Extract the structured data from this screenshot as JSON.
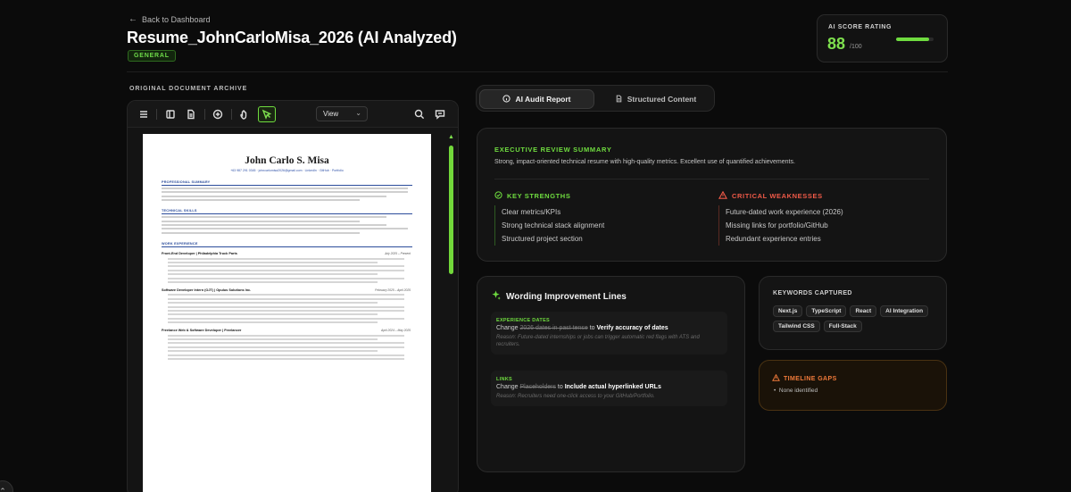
{
  "header": {
    "back_label": "Back to Dashboard",
    "title": "Resume_JohnCarloMisa_2026 (AI Analyzed)",
    "badge": "GENERAL"
  },
  "score": {
    "label": "AI SCORE RATING",
    "value": "88",
    "max": "/100",
    "progress_fraction": 0.88
  },
  "document": {
    "section_label": "ORIGINAL DOCUMENT ARCHIVE",
    "view_select": "View",
    "resume": {
      "name": "John Carlo S. Misa",
      "contact": "+63 987 291 0345  ·  johncarlomisa2026@gmail.com  ·  LinkedIn  ·  GitHub  ·  Portfolio",
      "sections": {
        "summary": "PROFESSIONAL SUMMARY",
        "skills": "TECHNICAL SKILLS",
        "experience": "WORK EXPERIENCE"
      },
      "jobs": [
        {
          "title": "Front-End Developer  |  Philadelphia Truck Parts",
          "date": "July 2025 – Present"
        },
        {
          "title": "Software Developer Intern (OJT)  |  Opulus Solutions Inc.",
          "date": "February 2025 – April 2025"
        },
        {
          "title": "Freelance Web & Software Developer  |  Freelancer",
          "date": "April 2024 – May 2025"
        }
      ]
    }
  },
  "tabs": [
    {
      "label": "AI Audit Report",
      "icon": "info-icon"
    },
    {
      "label": "Structured Content",
      "icon": "document-icon"
    }
  ],
  "executive": {
    "title": "EXECUTIVE REVIEW SUMMARY",
    "summary": "Strong, impact-oriented technical resume with high-quality metrics. Excellent use of quantified achievements.",
    "strengths_title": "KEY STRENGTHS",
    "strengths": [
      "Clear metrics/KPIs",
      "Strong technical stack alignment",
      "Structured project section"
    ],
    "weaknesses_title": "CRITICAL WEAKNESSES",
    "weaknesses": [
      "Future-dated work experience (2026)",
      "Missing links for portfolio/GitHub",
      "Redundant experience entries"
    ],
    "colors": {
      "accent_green": "#6fdc3f",
      "accent_red": "#f05a48"
    }
  },
  "wording": {
    "title": "Wording Improvement Lines",
    "items": [
      {
        "category": "EXPERIENCE DATES",
        "change_word": "Change",
        "old": "2026 dates in past tense",
        "to_word": "to",
        "new": "Verify accuracy of dates",
        "reason": "Reason: Future-dated internships or jobs can trigger automatic red flags with ATS and recruiters."
      },
      {
        "category": "LINKS",
        "change_word": "Change",
        "old": "Placeholders",
        "to_word": "to",
        "new": "Include actual hyperlinked URLs",
        "reason": "Reason: Recruiters need one-click access to your GitHub/Portfolio."
      }
    ]
  },
  "keywords": {
    "title": "KEYWORDS CAPTURED",
    "tags": [
      "Next.js",
      "TypeScript",
      "React",
      "AI Integration",
      "Tailwind CSS",
      "Full-Stack"
    ]
  },
  "timeline": {
    "title": "TIMELINE GAPS",
    "items": [
      "None identified"
    ]
  }
}
